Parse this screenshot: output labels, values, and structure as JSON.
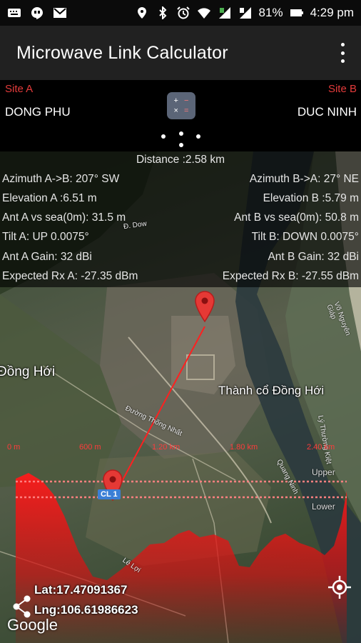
{
  "status_bar": {
    "battery": "81%",
    "time": "4:29 pm"
  },
  "app_bar": {
    "title": "Microwave Link Calculator",
    "overflow_icon": "more-vert-icon"
  },
  "sites": {
    "site_a_label": "Site A",
    "site_a_name": "DONG PHU",
    "site_b_label": "Site B",
    "site_b_name": "DUC NINH",
    "calculator_icon": "calculator-icon"
  },
  "link_info": {
    "distance": "Distance :2.58 km",
    "azimuth_a": "Azimuth A->B: 207° SW",
    "azimuth_b": "Azimuth B->A: 27° NE",
    "elevation_a": "Elevation A :6.51 m",
    "elevation_b": "Elevation B :5.79 m",
    "ant_a_sea": "Ant A vs sea(0m): 31.5 m",
    "ant_b_sea": "Ant B vs sea(0m): 50.8 m",
    "tilt_a": "Tilt A:  UP 0.0075°",
    "tilt_b": "Tilt B: DOWN 0.0075°",
    "gain_a": "Ant A Gain: 32 dBi",
    "gain_b": "Ant B Gain: 32 dBi",
    "rx_a": "Expected Rx A: -27.35 dBm",
    "rx_b": "Expected Rx B: -27.55 dBm"
  },
  "map": {
    "place_dong_hoi": "Đồng Hới",
    "place_citadel": "Thành cổ Đồng Hới",
    "road_thong_nhat": "Đường Thống Nhất",
    "road_vo_nguyen_giap": "Võ Nguyên Giáp",
    "road_quang_ninh": "Quang Ninh",
    "road_ly_thuong_kiet": "Lý Thường Kiệt",
    "road_la_lu": "Lê Lợi",
    "road_dow": "Đ. Dow",
    "pin_label": "CL 1",
    "profile": {
      "distance_labels": [
        "0 m",
        "600 m",
        "1.20 km",
        "1.80 km",
        "2.40 km"
      ],
      "upper": "Upper",
      "lower": "Lower",
      "fill_color": "#e01818"
    },
    "lat": "Lat:17.47091367",
    "lng": "Lng:106.61986623",
    "google": "Google"
  }
}
